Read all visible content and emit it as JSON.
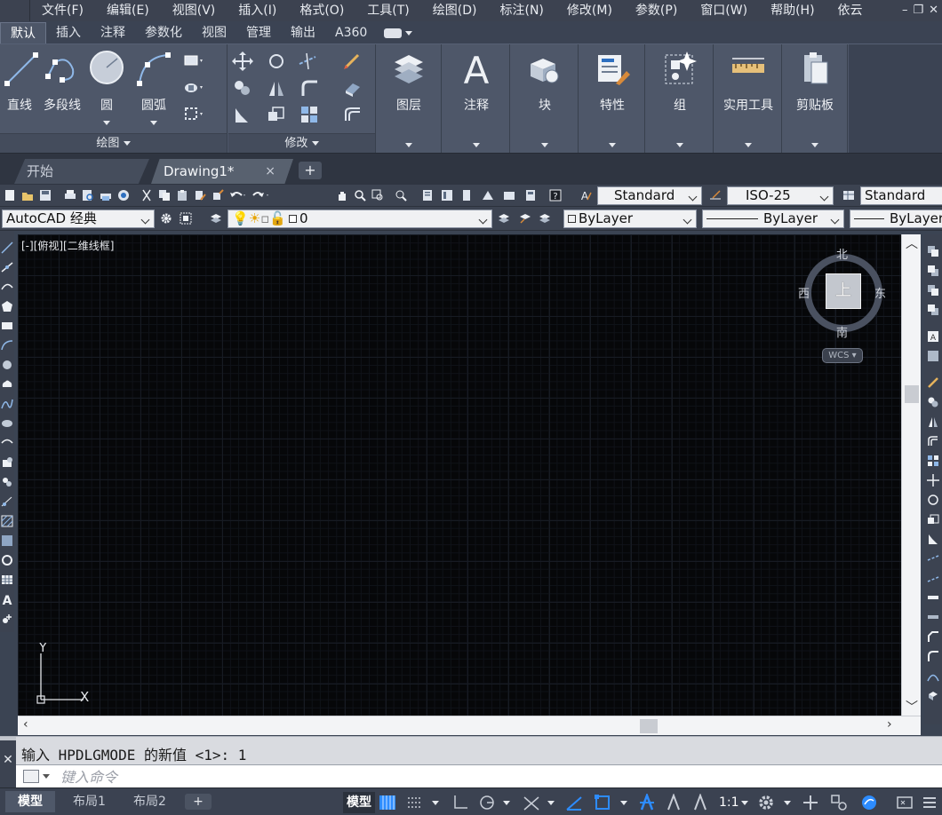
{
  "menubar": {
    "items": [
      "文件(F)",
      "编辑(E)",
      "视图(V)",
      "插入(I)",
      "格式(O)",
      "工具(T)",
      "绘图(D)",
      "标注(N)",
      "修改(M)",
      "参数(P)",
      "窗口(W)",
      "帮助(H)",
      "依云"
    ]
  },
  "ribbon_tabs": [
    "默认",
    "插入",
    "注释",
    "参数化",
    "视图",
    "管理",
    "输出",
    "A360"
  ],
  "ribbon": {
    "draw": {
      "title": "绘图",
      "line": "直线",
      "polyline": "多段线",
      "circle": "圆",
      "arc": "圆弧"
    },
    "modify": {
      "title": "修改"
    },
    "layers": "图层",
    "annotation": "注释",
    "block": "块",
    "properties": "特性",
    "groups": "组",
    "utilities": "实用工具",
    "clipboard": "剪贴板"
  },
  "doc_tabs": {
    "start": "开始",
    "drawing": "Drawing1*",
    "close": "×",
    "add": "+"
  },
  "toolbar1": {
    "text_style": "Standard",
    "dim_style": "ISO-25",
    "table_style": "Standard"
  },
  "toolbar2": {
    "workspace": "AutoCAD 经典",
    "layer": "0",
    "color": "ByLayer",
    "linetype": "ByLayer",
    "lineweight": "ByLayer"
  },
  "viewport": {
    "label": "[-][俯视][二维线框]",
    "compass": {
      "north": "北",
      "south": "南",
      "east": "东",
      "west": "西",
      "top": "上",
      "wcs": "WCS"
    },
    "ucs": {
      "x": "X",
      "y": "Y"
    }
  },
  "command": {
    "history": "输入 HPDLGMODE 的新值 <1>: 1",
    "placeholder": "键入命令"
  },
  "status": {
    "layout_tabs": [
      "模型",
      "布局1",
      "布局2"
    ],
    "model": "模型",
    "scale": "1:1"
  },
  "colors": {
    "ribbon_bg": "#4e5769",
    "viewport_bg": "#060709",
    "accent_blue": "#2d8cff"
  }
}
